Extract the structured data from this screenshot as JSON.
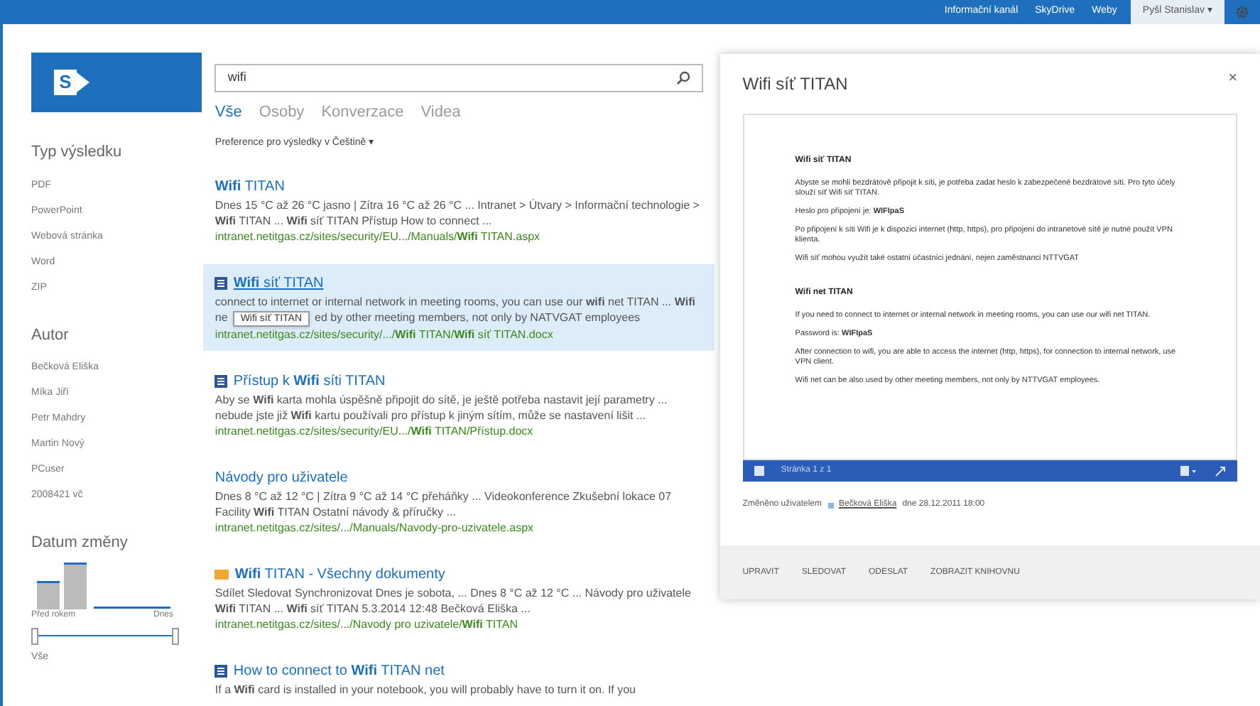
{
  "top_bar": {
    "links": [
      "Informační kanál",
      "SkyDrive",
      "Weby"
    ],
    "user": "Pyšl Stanislav",
    "user_caret": "▾"
  },
  "logo": {
    "letter": "S"
  },
  "search": {
    "value": "wifi"
  },
  "tabs": [
    {
      "label": "Vše",
      "selected": true
    },
    {
      "label": "Osoby",
      "selected": false
    },
    {
      "label": "Konverzace",
      "selected": false
    },
    {
      "label": "Videa",
      "selected": false
    }
  ],
  "preference": {
    "label": "Preference pro výsledky v Češtině",
    "caret": "▾"
  },
  "refiners": [
    {
      "title": "Typ výsledku",
      "items": [
        "PDF",
        "PowerPoint",
        "Webová stránka",
        "Word",
        "ZIP"
      ]
    },
    {
      "title": "Autor",
      "items": [
        "Bečková Eliška",
        "Míka Jiří",
        "Petr Mahdry",
        "Martin Nový",
        "PCuser",
        "2008421 vč"
      ]
    }
  ],
  "date_refiner": {
    "title": "Datum změny",
    "from": "Před rokem",
    "to": "Dnes",
    "value": "Vše",
    "level": 1
  },
  "results": [
    {
      "kind": "page",
      "selected": false,
      "title": "**Wifi** TITAN",
      "snippet": "Dnes 15 °C až 26 °C jasno | Zítra 16 °C až 26 °C ... Intranet > Útvary > Informační technologie > **Wifi** TITAN ... **Wifi** síť TITAN Přístup How to connect ...",
      "url": "intranet.netitgas.cz/sites/security/EU.../Manuals/**Wifi** TITAN.aspx"
    },
    {
      "kind": "document",
      "selected": true,
      "title": "**Wifi** síť TITAN",
      "snippet": "connect to internet or internal network in meeting rooms, you can use our **wifi** net TITAN ... **Wifi** ne",
      "tooltip": "Wifi síť TITAN",
      "snippet_end": "ed by other meeting members, not only by NATVGAT employees",
      "url": "intranet.netitgas.cz/sites/security/.../**Wifi** TITAN/**Wifi** síť TITAN.docx"
    },
    {
      "kind": "document",
      "selected": false,
      "title": "Přístup k **Wifi** síti TITAN",
      "snippet": "Aby se **Wifi** karta mohla úspěšně připojit do sítě, je ještě potřeba nastavit její parametry ... nebude jste již **Wifi** kartu používali pro přístup k jiným sítím, může se nastavení lišit ...",
      "url": "intranet.netitgas.cz/sites/security/EU.../**Wifi** TITAN/Přístup.docx"
    },
    {
      "kind": "page",
      "selected": false,
      "title": "Návody pro uživatele",
      "snippet": "Dnes 8 °C až 12 °C | Zítra 9 °C až 14 °C přeháňky ... Videokonference Zkušební lokace 07 Facility **Wifi** TITAN Ostatní návody & příručky ...",
      "url": "intranet.netitgas.cz/sites/.../Manuals/Navody-pro-uzivatele.aspx"
    },
    {
      "kind": "library",
      "selected": false,
      "title": "**Wifi** TITAN - Všechny dokumenty",
      "snippet": "Sdílet Sledovat Synchronizovat Dnes je sobota, ... Dnes 8 °C až 12 °C ... Návody pro uživatele **Wifi** TITAN ... **Wifi** síť TITAN   5.3.2014 12:48 Bečková Eliška ...",
      "url": "intranet.netitgas.cz/sites/.../Navody pro uzivatele/**Wifi** TITAN"
    },
    {
      "kind": "document",
      "selected": false,
      "title": "How to connect to **Wifi** TITAN net",
      "snippet": "If a **Wifi** card is installed in your notebook, you will probably have to turn it on. If you"
    }
  ],
  "preview": {
    "title": "Wifi síť TITAN",
    "close": "×",
    "document": [
      {
        "kind": "heading",
        "text": "Wifi síť TITAN"
      },
      {
        "kind": "paragraph",
        "text": "Abyste se mohli bezdrátově připojit k síti, je potřeba zadat heslo k zabezpečené bezdrátové síti. Pro tyto účely slouží síť Wifi síť TITAN."
      },
      {
        "kind": "paragraph",
        "text": "Heslo pro připojení je: **WIFIpaS**"
      },
      {
        "kind": "paragraph",
        "text": "Po připojení k síti Wifi je k dispozici internet (http, https), pro připojení do intranetové sítě je nutné použít VPN klienta."
      },
      {
        "kind": "paragraph",
        "text": "Wifi síť mohou využít také ostatní účastníci jednání, nejen zaměstnanci NTTVGAT"
      },
      {
        "kind": "heading",
        "text": "Wifi net TITAN"
      },
      {
        "kind": "paragraph",
        "text": "If you need to connect to internet or internal network in meeting rooms, you can use our wifi net TITAN."
      },
      {
        "kind": "paragraph",
        "text": "Password is: **WIFIpaS**"
      },
      {
        "kind": "paragraph",
        "text": "After connection to wifi, you are able to access the internet (http, https), for connection to internal network, use VPN client."
      },
      {
        "kind": "paragraph",
        "text": "Wifi net can be also used by other meeting members, not only by NTTVGAT employees."
      }
    ],
    "page_label": "Stránka 1 z 1",
    "modified_by": "Změněno uživatelem",
    "author": "Bečková Eliška",
    "modified_date": "dne 28.12.2011 18:00",
    "actions": [
      "UPRAVIT",
      "SLEDOVAT",
      "ODESLAT",
      "ZOBRAZIT KNIHOVNU"
    ]
  }
}
